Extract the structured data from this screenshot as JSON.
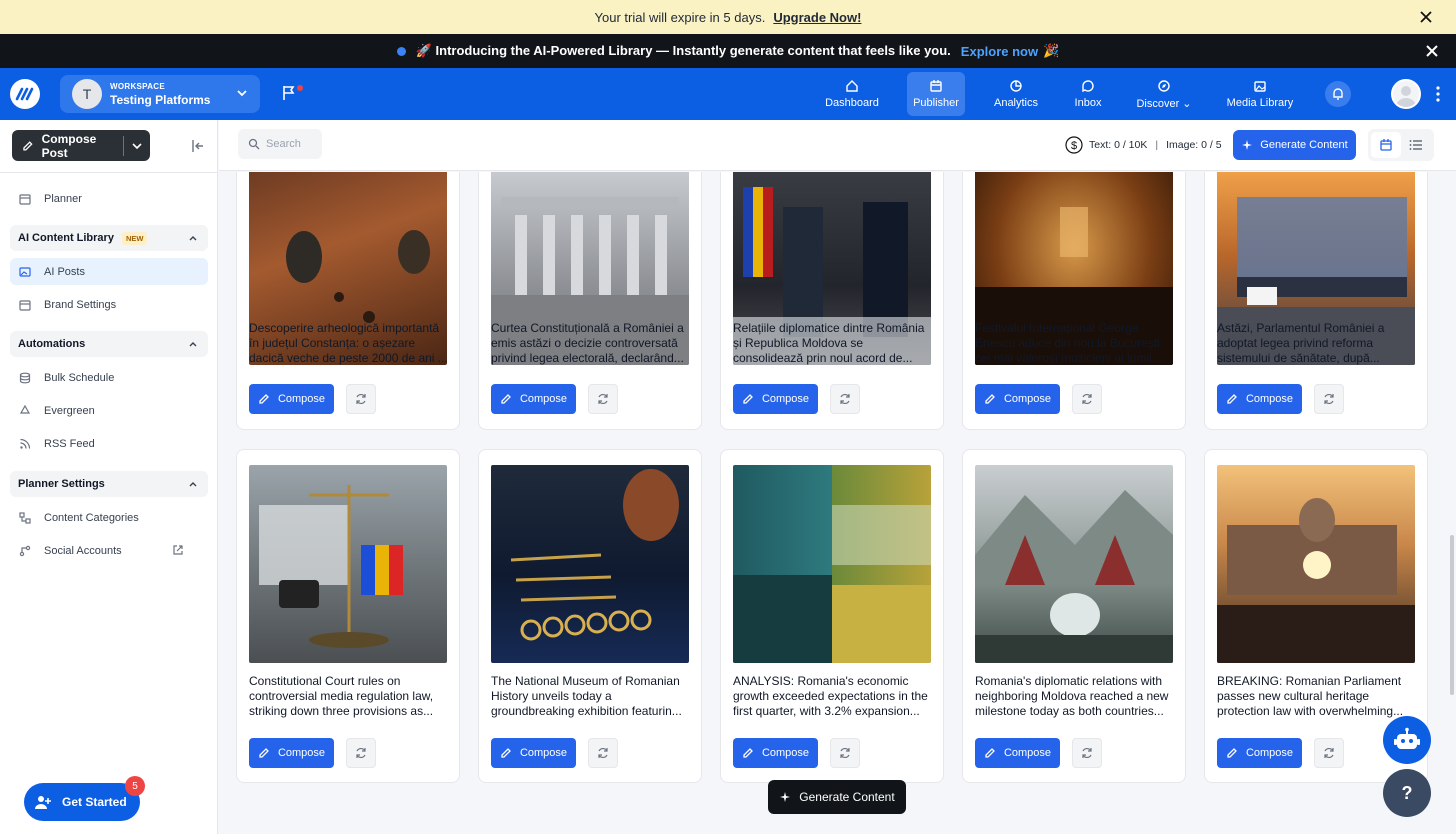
{
  "trial": {
    "text": "Your trial will expire in 5 days.",
    "upgrade": "Upgrade Now!"
  },
  "announce": {
    "text": "🚀 Introducing the AI-Powered Library — Instantly generate content that feels like you.",
    "explore": "Explore now",
    "emoji": "🎉"
  },
  "workspace": {
    "initial": "T",
    "label": "WORKSPACE",
    "name": "Testing Platforms"
  },
  "nav": {
    "items": [
      {
        "label": "Dashboard",
        "icon": "home-icon"
      },
      {
        "label": "Publisher",
        "icon": "calendar-icon",
        "active": true
      },
      {
        "label": "Analytics",
        "icon": "pie-chart-icon"
      },
      {
        "label": "Inbox",
        "icon": "chat-icon"
      },
      {
        "label": "Discover",
        "icon": "compass-icon"
      },
      {
        "label": "Media Library",
        "icon": "gallery-icon"
      }
    ]
  },
  "sidebar": {
    "compose_label": "Compose Post",
    "planner": "Planner",
    "ai_group": "AI Content Library",
    "new_badge": "NEW",
    "ai_posts": "AI Posts",
    "brand_settings": "Brand Settings",
    "automations": "Automations",
    "bulk_schedule": "Bulk Schedule",
    "evergreen": "Evergreen",
    "rss_feed": "RSS Feed",
    "planner_settings": "Planner Settings",
    "content_categories": "Content Categories",
    "social_accounts": "Social Accounts",
    "get_started": "Get Started",
    "get_started_count": "5"
  },
  "toolbar": {
    "search_placeholder": "Search",
    "text_usage": "Text: 0 / 10K",
    "separator": "|",
    "image_usage": "Image: 0 / 5",
    "generate": "Generate Content"
  },
  "cards": {
    "compose_label": "Compose",
    "row1": [
      {
        "text": "Descoperire arheologică importantă în județul Constanța: o așezare dacică veche de peste 2000 de ani ..."
      },
      {
        "text": "Curtea Constituțională a României a emis astăzi o decizie controversată privind legea electorală, declarând..."
      },
      {
        "text": "Relațiile diplomatice dintre România și Republica Moldova se consolidează prin noul acord de..."
      },
      {
        "text": "Festivalul Internațional George Enescu aduce din nou la București cei mai valoroși muzicieni ai lumii...."
      },
      {
        "text": "Astăzi, Parlamentul României a adoptat legea privind reforma sistemului de sănătate, după..."
      }
    ],
    "row2": [
      {
        "text": "Constitutional Court rules on controversial media regulation law, striking down three provisions as..."
      },
      {
        "text": "The National Museum of Romanian History unveils today a groundbreaking exhibition featurin..."
      },
      {
        "text": "ANALYSIS: Romania's economic growth exceeded expectations in the first quarter, with 3.2% expansion..."
      },
      {
        "text": "Romania's diplomatic relations with neighboring Moldova reached a new milestone today as both countries..."
      },
      {
        "text": "BREAKING: Romanian Parliament passes new cultural heritage protection law with overwhelming..."
      }
    ]
  },
  "floating": {
    "generate": "Generate Content",
    "help": "?"
  },
  "colors": {
    "brand": "#0c5fe3",
    "button": "#2563eb",
    "trial_bg": "#fbf2c4"
  }
}
